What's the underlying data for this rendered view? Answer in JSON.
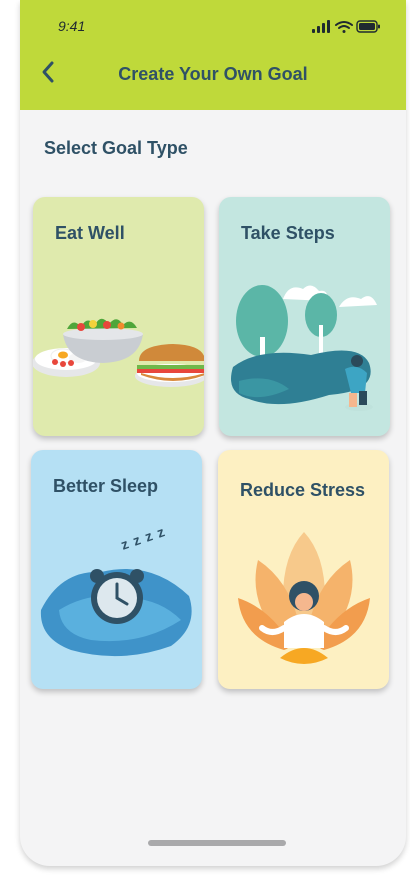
{
  "status_bar": {
    "time": "9:41"
  },
  "header": {
    "title": "Create Your Own Goal",
    "back_icon": "chevron-left-icon",
    "background": "#bfd93a"
  },
  "main": {
    "section_title": "Select Goal Type",
    "cards": [
      {
        "label": "Eat Well",
        "color": "#dfeaad",
        "illustration": "food-plates-icon"
      },
      {
        "label": "Take Steps",
        "color": "#c3e6e0",
        "illustration": "walking-park-icon"
      },
      {
        "label": "Better Sleep",
        "color": "#b5e0f4",
        "illustration": "alarm-clock-pillow-icon"
      },
      {
        "label": "Reduce Stress",
        "color": "#fdf0c2",
        "illustration": "meditation-lotus-icon"
      }
    ]
  },
  "colors": {
    "text": "#2f5166",
    "background": "#f4f4f5"
  }
}
